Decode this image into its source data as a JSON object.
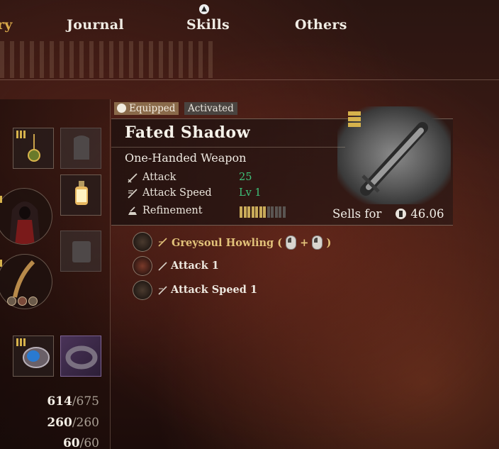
{
  "nav": {
    "tabs": [
      {
        "label": "ry",
        "active": true
      },
      {
        "label": "Journal",
        "active": false
      },
      {
        "label": "Skills",
        "active": false
      },
      {
        "label": "Others",
        "active": false
      }
    ],
    "hint_icon": "up-arrow-button-icon"
  },
  "tags": {
    "equipped": "Equipped",
    "activated": "Activated"
  },
  "item": {
    "name": "Fated Shadow",
    "type": "One-Handed Weapon",
    "stats": [
      {
        "label": "Attack",
        "value": "25",
        "icon": "sword-icon"
      },
      {
        "label": "Attack Speed",
        "value": "Lv 1",
        "icon": "attack-speed-icon"
      },
      {
        "label": "Refinement",
        "value": "",
        "icon": "refinement-icon"
      }
    ],
    "refinement": {
      "filled": 7,
      "total": 12
    },
    "sells_label": "Sells for",
    "sells_value": "46.06",
    "image": "ornate-sword-image",
    "tier_marks": 3
  },
  "effects": [
    {
      "icon": "greysoul-howling-icon",
      "name": "Greysoul Howling",
      "open": "(",
      "plus": "+",
      "close": ")",
      "gold": true
    },
    {
      "icon": "attack-boost-icon",
      "name": "Attack 1",
      "gold": false
    },
    {
      "icon": "attack-speed-boost-icon",
      "name": "Attack Speed 1",
      "gold": false
    }
  ],
  "character": {
    "stats": [
      {
        "current": "614",
        "max": "/675"
      },
      {
        "current": "260",
        "max": "/260"
      },
      {
        "current": "60",
        "max": "/60"
      }
    ]
  },
  "colors": {
    "accent_gold": "#d8a84a",
    "stat_green": "#3fc27a",
    "equipped_tag": "#8a6a4a",
    "activated_tag": "#4a4440"
  }
}
